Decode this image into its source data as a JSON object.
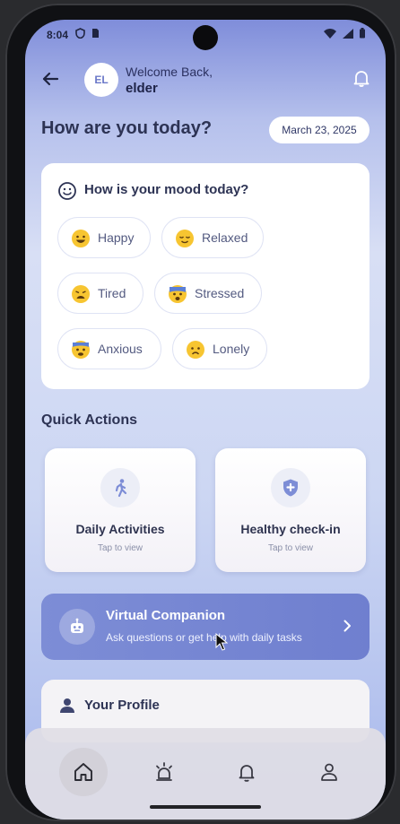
{
  "status_bar": {
    "time": "8:04",
    "left_icons": [
      "shield-icon",
      "sim-icon"
    ],
    "right_icons": [
      "wifi-icon",
      "signal-icon",
      "battery-icon"
    ]
  },
  "header": {
    "avatar_initials": "EL",
    "welcome_text": "Welcome Back,",
    "username": "elder"
  },
  "greeting": {
    "title": "How are you today?",
    "date": "March 23, 2025"
  },
  "mood": {
    "title": "How is your mood today?",
    "options": [
      {
        "label": "Happy",
        "icon": "grinning-face-icon"
      },
      {
        "label": "Relaxed",
        "icon": "relieved-face-icon"
      },
      {
        "label": "Tired",
        "icon": "tired-face-icon"
      },
      {
        "label": "Stressed",
        "icon": "fearful-face-icon"
      },
      {
        "label": "Anxious",
        "icon": "anxious-face-icon"
      },
      {
        "label": "Lonely",
        "icon": "sad-face-icon"
      }
    ]
  },
  "quick_actions": {
    "title": "Quick Actions",
    "items": [
      {
        "label": "Daily Activities",
        "sub": "Tap to view",
        "icon": "walking-person-icon"
      },
      {
        "label": "Healthy check-in",
        "sub": "Tap to view",
        "icon": "shield-plus-icon"
      }
    ]
  },
  "companion": {
    "title": "Virtual Companion",
    "subtitle": "Ask questions or get help with daily tasks",
    "icon": "robot-icon"
  },
  "profile": {
    "title": "Your Profile",
    "icon": "person-icon"
  },
  "bottom_nav": {
    "items": [
      "home-icon",
      "alarm-light-icon",
      "bell-icon",
      "person-icon"
    ],
    "active": "home-icon"
  },
  "colors": {
    "accent": "#7d8dd6",
    "header_gradient_top": "#7f8dda",
    "card_bg": "#ffffff",
    "text_dark": "#2d3354"
  }
}
